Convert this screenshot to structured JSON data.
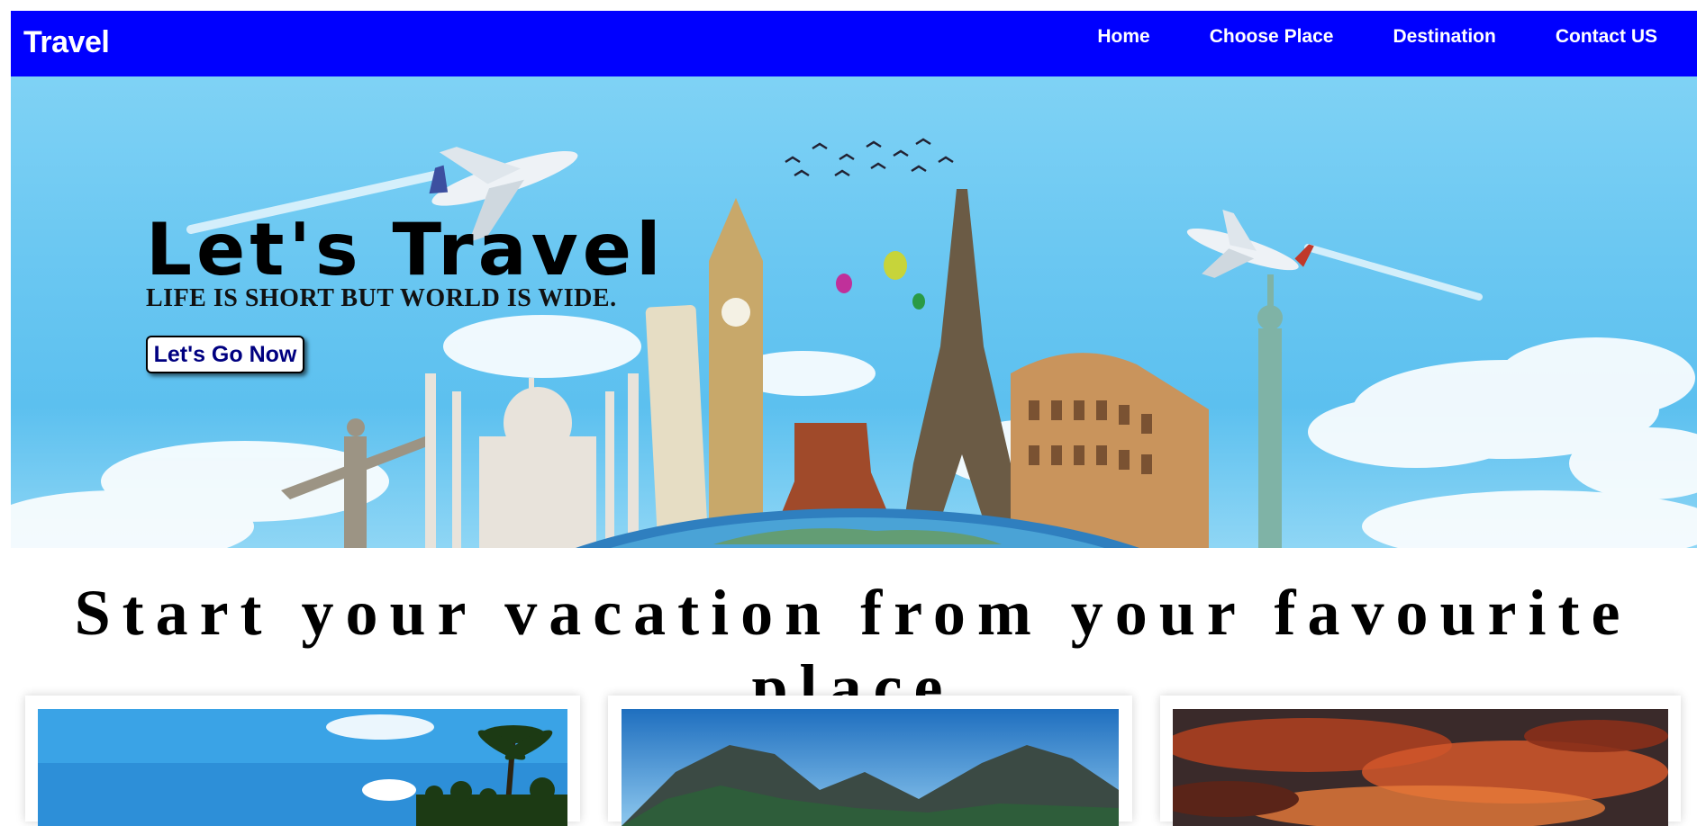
{
  "nav": {
    "brand": "Travel",
    "links": [
      "Home",
      "Choose Place",
      "Destination",
      "Contact US"
    ],
    "bg_color": "#0000ff"
  },
  "hero": {
    "title": "Let's Travel",
    "subtitle": "LIFE IS SHORT BUT WORLD IS WIDE.",
    "button_label": "Let's Go Now"
  },
  "section": {
    "title": "Start your vacation from your favourite place"
  },
  "cards": [
    {
      "image": "tropical-beach-image"
    },
    {
      "image": "mountain-lake-image"
    },
    {
      "image": "sunset-sky-image"
    }
  ]
}
